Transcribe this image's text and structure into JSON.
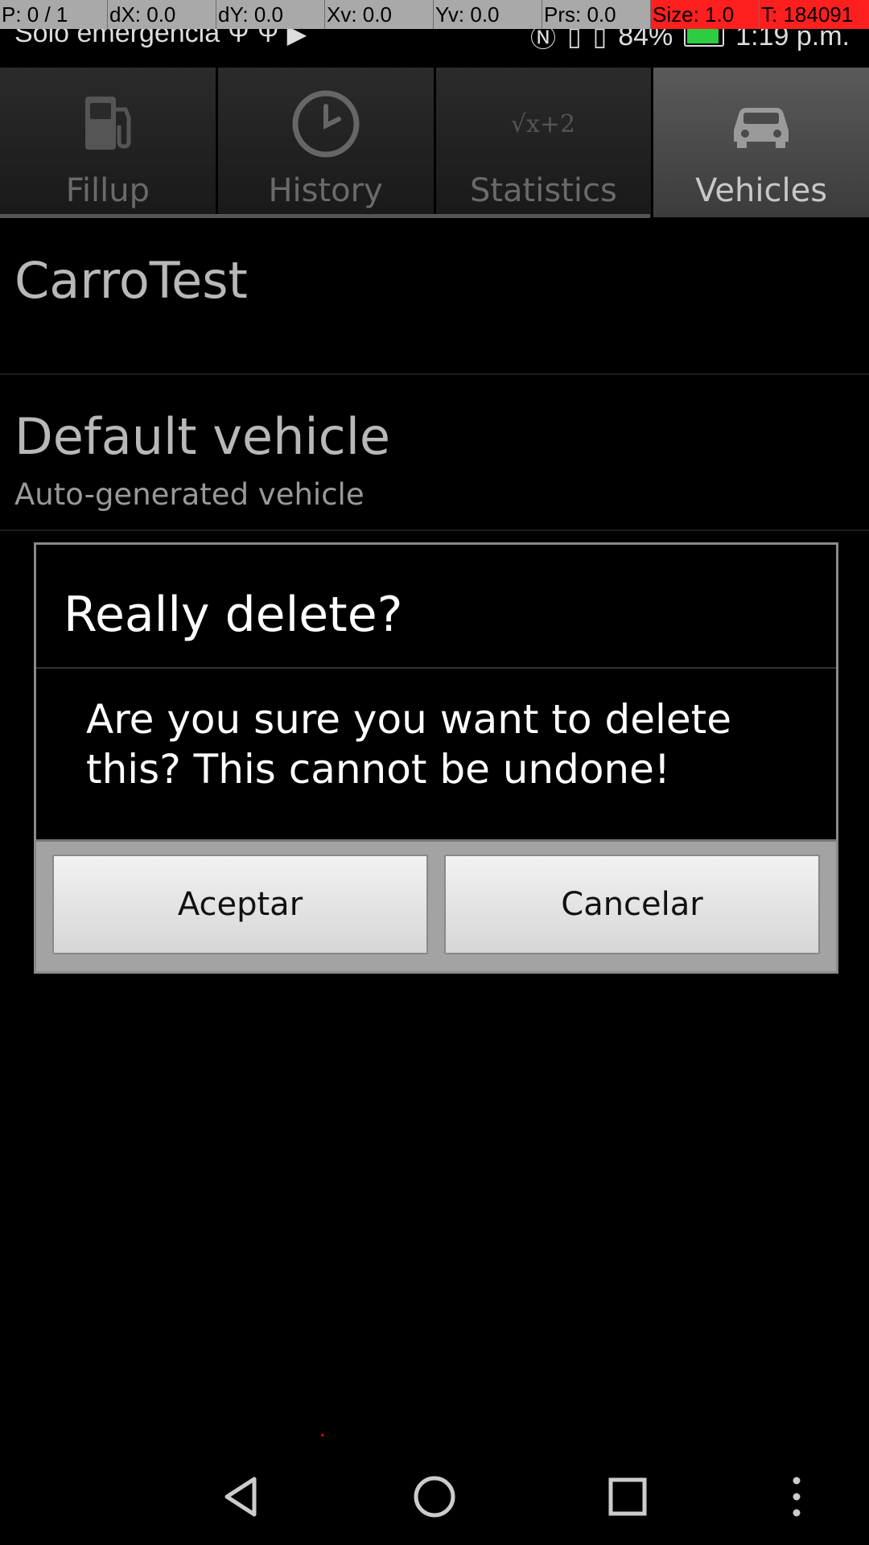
{
  "debug_bar": {
    "p": "P: 0 / 1",
    "dx": "dX: 0.0",
    "dy": "dY: 0.0",
    "xv": "Xv: 0.0",
    "yv": "Yv: 0.0",
    "prs": "Prs: 0.0",
    "size": "Size: 1.0",
    "t": "T: 184091"
  },
  "status_bar": {
    "carrier": "Solo emergencia",
    "battery_percent": "84%",
    "time": "1:19 p.m.",
    "battery_level": 0.84,
    "battery_color": "#2ecc40"
  },
  "tabs": [
    {
      "label": "Fillup",
      "icon": "fuel-pump-icon"
    },
    {
      "label": "History",
      "icon": "clock-icon"
    },
    {
      "label": "Statistics",
      "icon": "sqrt-formula-icon",
      "icon_text": "√x+2"
    },
    {
      "label": "Vehicles",
      "icon": "car-icon"
    }
  ],
  "active_tab": "Vehicles",
  "vehicles": [
    {
      "name": "CarroTest",
      "description": ""
    },
    {
      "name": "Default vehicle",
      "description": "Auto-generated vehicle"
    }
  ],
  "dialog": {
    "title": "Really delete?",
    "message": "Are you sure you want to delete this? This cannot be undone!",
    "accept_label": "Aceptar",
    "cancel_label": "Cancelar"
  },
  "colors": {
    "background": "#000000",
    "active_tab": "#4a4a4a",
    "dialog_button_bar": "#a3a3a3",
    "debug_highlight": "#ff1f1f"
  }
}
